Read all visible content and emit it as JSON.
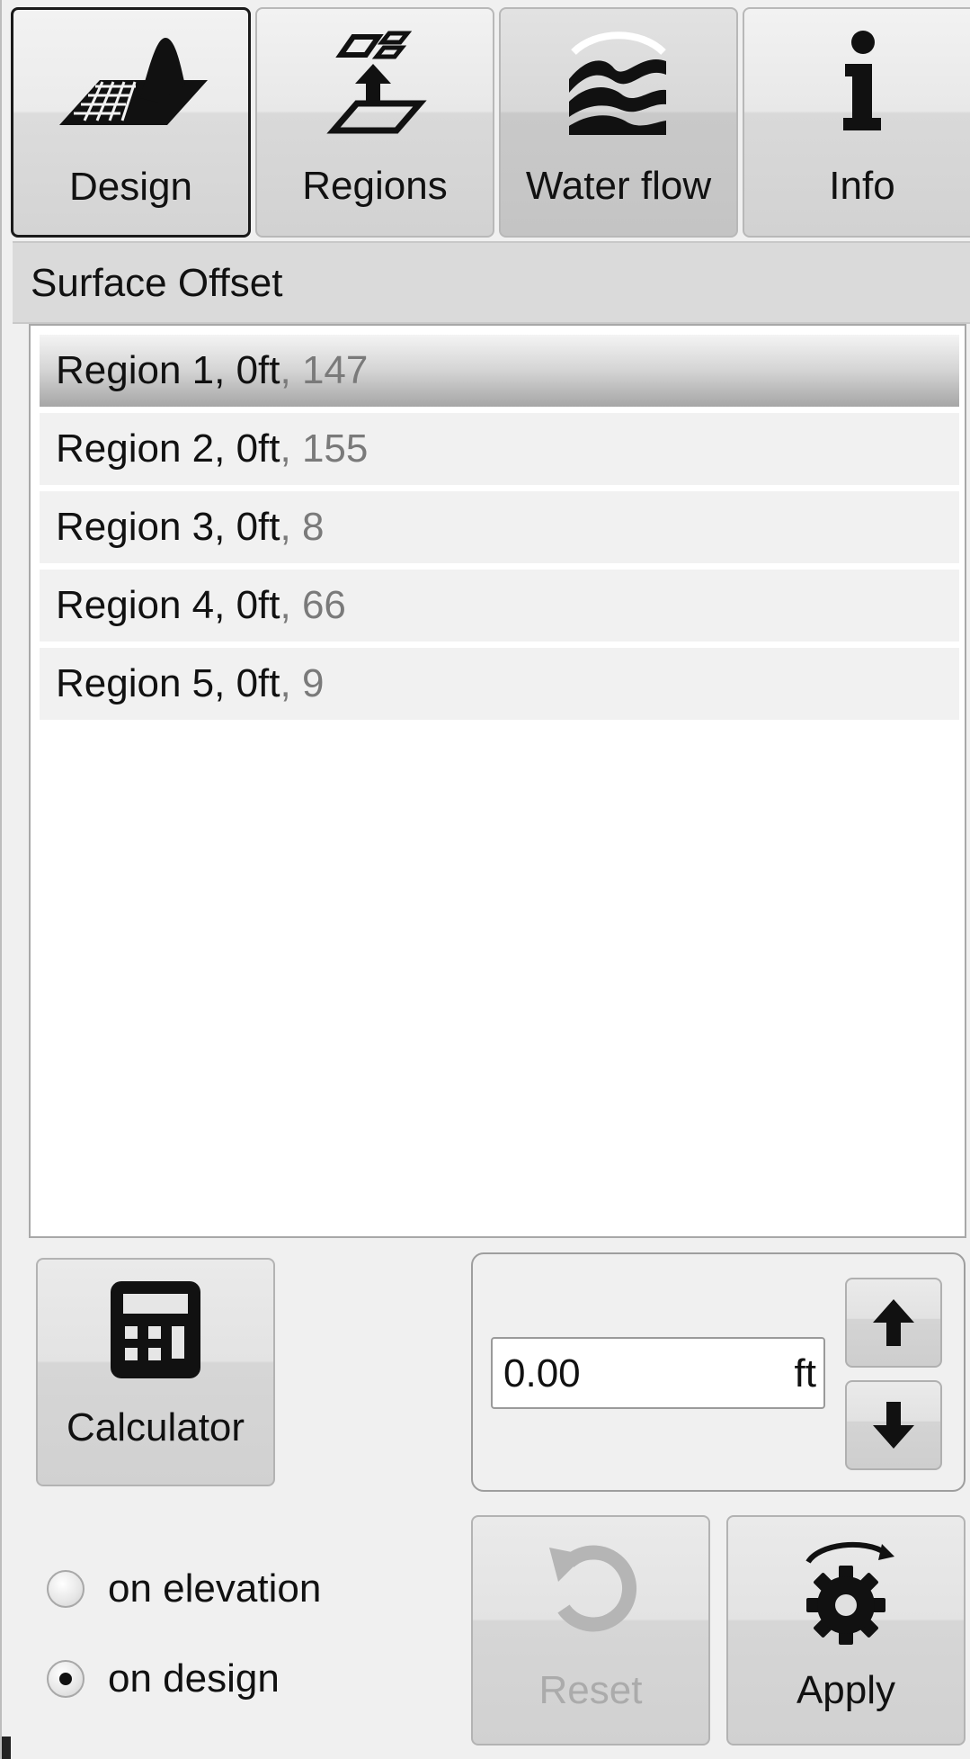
{
  "tabs": [
    {
      "label": "Design",
      "icon": "design-surface-icon",
      "active": true
    },
    {
      "label": "Regions",
      "icon": "regions-icon",
      "active": false
    },
    {
      "label": "Water flow",
      "icon": "water-flow-icon",
      "active": false
    },
    {
      "label": "Info",
      "icon": "info-icon",
      "active": false
    }
  ],
  "section": {
    "title": "Surface Offset"
  },
  "regions": [
    {
      "label": "Region 1, 0ft",
      "count": ", 147",
      "selected": true
    },
    {
      "label": "Region 2, 0ft",
      "count": ", 155",
      "selected": false
    },
    {
      "label": "Region 3, 0ft",
      "count": ", 8",
      "selected": false
    },
    {
      "label": "Region 4, 0ft",
      "count": ", 66",
      "selected": false
    },
    {
      "label": "Region 5, 0ft",
      "count": ", 9",
      "selected": false
    }
  ],
  "calculator": {
    "label": "Calculator",
    "icon": "calculator-icon"
  },
  "offset": {
    "value": "0.00",
    "unit": "ft",
    "up_icon": "arrow-up-icon",
    "down_icon": "arrow-down-icon"
  },
  "mode": {
    "options": [
      "on elevation",
      "on design"
    ],
    "selected": "on design"
  },
  "reset": {
    "label": "Reset",
    "icon": "undo-icon",
    "enabled": false
  },
  "apply": {
    "label": "Apply",
    "icon": "gear-rotate-icon",
    "enabled": true
  }
}
